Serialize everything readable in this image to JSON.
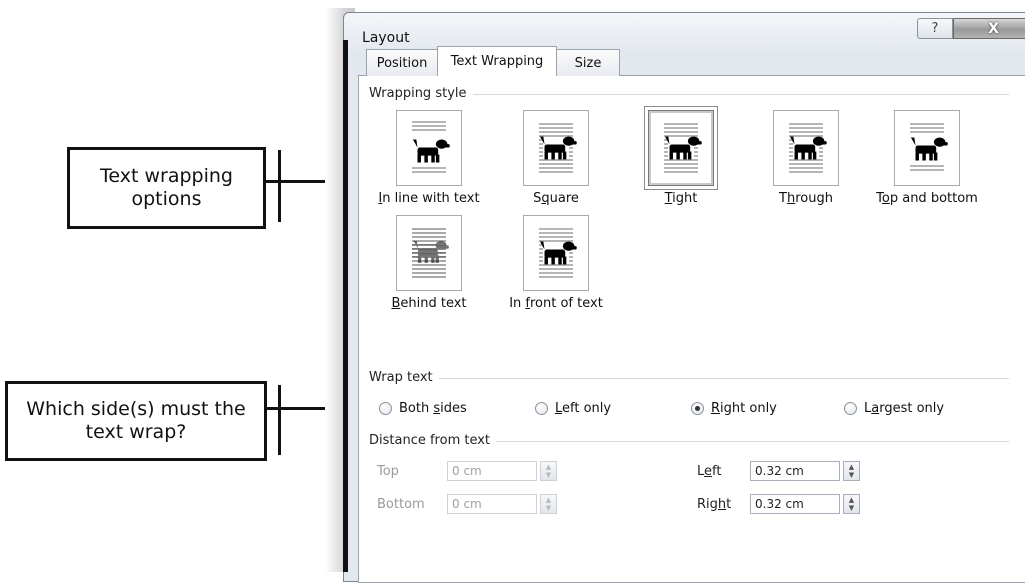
{
  "dialog": {
    "title": "Layout",
    "help_glyph": "?",
    "close_glyph": "X"
  },
  "tabs": [
    {
      "label": "Position"
    },
    {
      "label": "Text Wrapping",
      "active": true
    },
    {
      "label": "Size"
    }
  ],
  "wrapping_style": {
    "heading": "Wrapping style",
    "options": [
      {
        "pre": "",
        "key": "I",
        "post": "n line with text",
        "icon": "inline-dog-icon"
      },
      {
        "pre": "S",
        "key": "q",
        "post": "uare",
        "icon": "square-dog-icon"
      },
      {
        "pre": "",
        "key": "T",
        "post": "ight",
        "icon": "tight-dog-icon",
        "selected": true
      },
      {
        "pre": "T",
        "key": "h",
        "post": "rough",
        "icon": "through-dog-icon"
      },
      {
        "pre": "T",
        "key": "o",
        "post": "p and bottom",
        "icon": "top-bottom-dog-icon"
      },
      {
        "pre": "",
        "key": "B",
        "post": "ehind text",
        "icon": "behind-dog-icon"
      },
      {
        "pre": "In ",
        "key": "f",
        "post": "ront of text",
        "icon": "front-dog-icon"
      }
    ]
  },
  "wrap_text": {
    "heading": "Wrap text",
    "options": [
      {
        "pre": "Both ",
        "key": "s",
        "post": "ides",
        "checked": false
      },
      {
        "pre": "",
        "key": "L",
        "post": "eft only",
        "checked": false
      },
      {
        "pre": "",
        "key": "R",
        "post": "ight only",
        "checked": true
      },
      {
        "pre": "L",
        "key": "a",
        "post": "rgest only",
        "checked": false
      }
    ]
  },
  "distance": {
    "heading": "Distance from text",
    "top": {
      "label": "Top",
      "value": "0 cm"
    },
    "bottom": {
      "label": "Bottom",
      "value": "0 cm"
    },
    "left": {
      "pre": "L",
      "key": "e",
      "post": "ft",
      "value": "0.32 cm"
    },
    "right": {
      "pre": "Rig",
      "key": "h",
      "post": "t",
      "value": "0.32 cm"
    }
  },
  "callouts": {
    "wrapping": "Text wrapping options",
    "sides": "Which side(s) must the text wrap?"
  }
}
